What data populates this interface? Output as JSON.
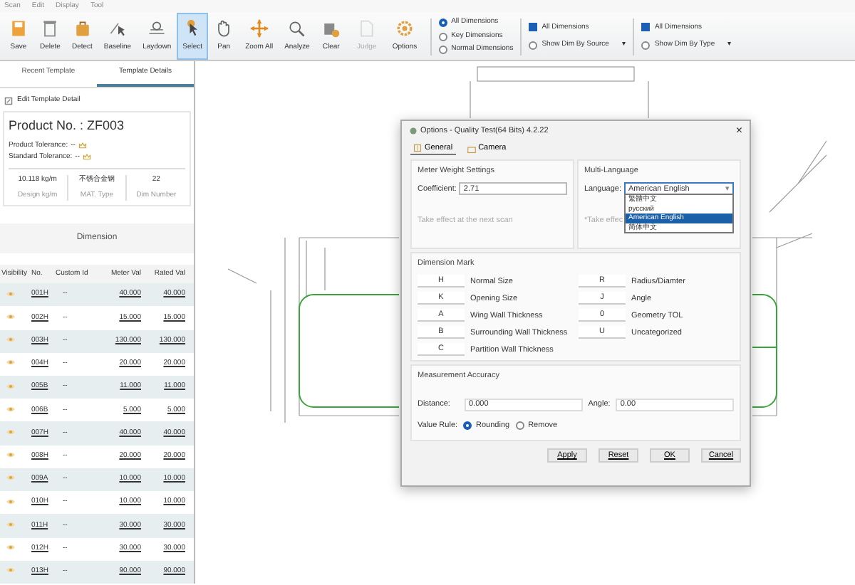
{
  "menu": [
    "Scan",
    "Edit",
    "Display",
    "Tool"
  ],
  "toolbar": [
    {
      "label": "Save",
      "selected": false,
      "disabled": false
    },
    {
      "label": "Delete",
      "selected": false,
      "disabled": false
    },
    {
      "label": "Detect",
      "selected": false,
      "disabled": false
    },
    {
      "label": "Baseline",
      "selected": false,
      "disabled": false
    },
    {
      "label": "Laydown",
      "selected": false,
      "disabled": false
    },
    {
      "label": "Select",
      "selected": true,
      "disabled": false
    },
    {
      "label": "Pan",
      "selected": false,
      "disabled": false
    },
    {
      "label": "Zoom All",
      "selected": false,
      "disabled": false
    },
    {
      "label": "Analyze",
      "selected": false,
      "disabled": false
    },
    {
      "label": "Clear",
      "selected": false,
      "disabled": false
    },
    {
      "label": "Judge",
      "selected": false,
      "disabled": true
    },
    {
      "label": "Options",
      "selected": false,
      "disabled": false
    }
  ],
  "dimension_filter": [
    {
      "label": "All Dimensions",
      "selected": true
    },
    {
      "label": "Key Dimensions",
      "selected": false
    },
    {
      "label": "Normal Dimensions",
      "selected": false
    }
  ],
  "source_filter": {
    "all": {
      "label": "All Dimensions",
      "checked": true
    },
    "show": {
      "label": "Show Dim By Source",
      "selected": false
    },
    "caret": "▾"
  },
  "type_filter": {
    "all": {
      "label": "All Dimensions",
      "checked": true
    },
    "show": {
      "label": "Show Dim By Type",
      "selected": false
    },
    "caret": "▾"
  },
  "left_tabs": [
    {
      "label": "Recent Template",
      "selected": false
    },
    {
      "label": "Template Details",
      "selected": true
    }
  ],
  "edit_link": "Edit Template Detail",
  "product": {
    "title": "Product No. : ZF003",
    "tolerances": [
      {
        "label": "Product Tolerance:",
        "value": "--"
      },
      {
        "label": "Standard Tolerance:",
        "value": "--"
      }
    ],
    "stats": [
      {
        "value": "10.118 kg/m",
        "label": "Design kg/m"
      },
      {
        "value": "不锈合金钢",
        "label": "MAT. Type"
      },
      {
        "value": "22",
        "label": "Dim Number"
      }
    ]
  },
  "dimension_header": "Dimension",
  "table": {
    "columns": [
      "Visibility",
      "No.",
      "Custom Id",
      "Meter Val",
      "Rated Val"
    ],
    "rows": [
      {
        "no": "001H",
        "custom": "--",
        "meter": "40.000",
        "rated": "40.000"
      },
      {
        "no": "002H",
        "custom": "--",
        "meter": "15.000",
        "rated": "15.000"
      },
      {
        "no": "003H",
        "custom": "--",
        "meter": "130.000",
        "rated": "130.000"
      },
      {
        "no": "004H",
        "custom": "--",
        "meter": "20.000",
        "rated": "20.000"
      },
      {
        "no": "005B",
        "custom": "--",
        "meter": "11.000",
        "rated": "11.000"
      },
      {
        "no": "006B",
        "custom": "--",
        "meter": "5.000",
        "rated": "5.000"
      },
      {
        "no": "007H",
        "custom": "--",
        "meter": "40.000",
        "rated": "40.000"
      },
      {
        "no": "008H",
        "custom": "--",
        "meter": "20.000",
        "rated": "20.000"
      },
      {
        "no": "009A",
        "custom": "--",
        "meter": "10.000",
        "rated": "10.000"
      },
      {
        "no": "010H",
        "custom": "--",
        "meter": "10.000",
        "rated": "10.000"
      },
      {
        "no": "011H",
        "custom": "--",
        "meter": "30.000",
        "rated": "30.000"
      },
      {
        "no": "012H",
        "custom": "--",
        "meter": "30.000",
        "rated": "30.000"
      },
      {
        "no": "013H",
        "custom": "--",
        "meter": "90.000",
        "rated": "90.000"
      }
    ]
  },
  "dialog": {
    "title": "Options - Quality Test(64 Bits) 4.2.22",
    "close": "×",
    "tabs": [
      {
        "label": "General",
        "selected": true
      },
      {
        "label": "Camera",
        "selected": false
      }
    ],
    "meter_weight": {
      "title": "Meter Weight Settings",
      "label": "Coefficient:",
      "value": "2.71",
      "note": "Take effect at the next scan"
    },
    "multi_language": {
      "title": "Multi-Language",
      "label": "Language:",
      "value": "American English",
      "note": "*Take effec",
      "options": [
        {
          "label": "繁體中文",
          "selected": false
        },
        {
          "label": "русский",
          "selected": false
        },
        {
          "label": "American English",
          "selected": true
        },
        {
          "label": "简体中文",
          "selected": false
        }
      ]
    },
    "dimension_mark": {
      "title": "Dimension Mark",
      "items": [
        {
          "code": "H",
          "label": "Normal Size"
        },
        {
          "code": "R",
          "label": "Radius/Diamter"
        },
        {
          "code": "K",
          "label": "Opening Size"
        },
        {
          "code": "J",
          "label": "Angle"
        },
        {
          "code": "A",
          "label": "Wing Wall Thickness"
        },
        {
          "code": "0",
          "label": "Geometry TOL"
        },
        {
          "code": "B",
          "label": "Surrounding Wall Thickness"
        },
        {
          "code": "U",
          "label": "Uncategorized"
        },
        {
          "code": "C",
          "label": "Partition Wall Thickness"
        }
      ]
    },
    "accuracy": {
      "title": "Measurement Accuracy",
      "distance_label": "Distance:",
      "distance": "0.000",
      "angle_label": "Angle:",
      "angle": "0.00",
      "rule_label": "Value Rule:",
      "rules": [
        {
          "label": "Rounding",
          "selected": true
        },
        {
          "label": "Remove",
          "selected": false
        }
      ]
    },
    "buttons": [
      "Apply",
      "Reset",
      "OK",
      "Cancel"
    ]
  }
}
